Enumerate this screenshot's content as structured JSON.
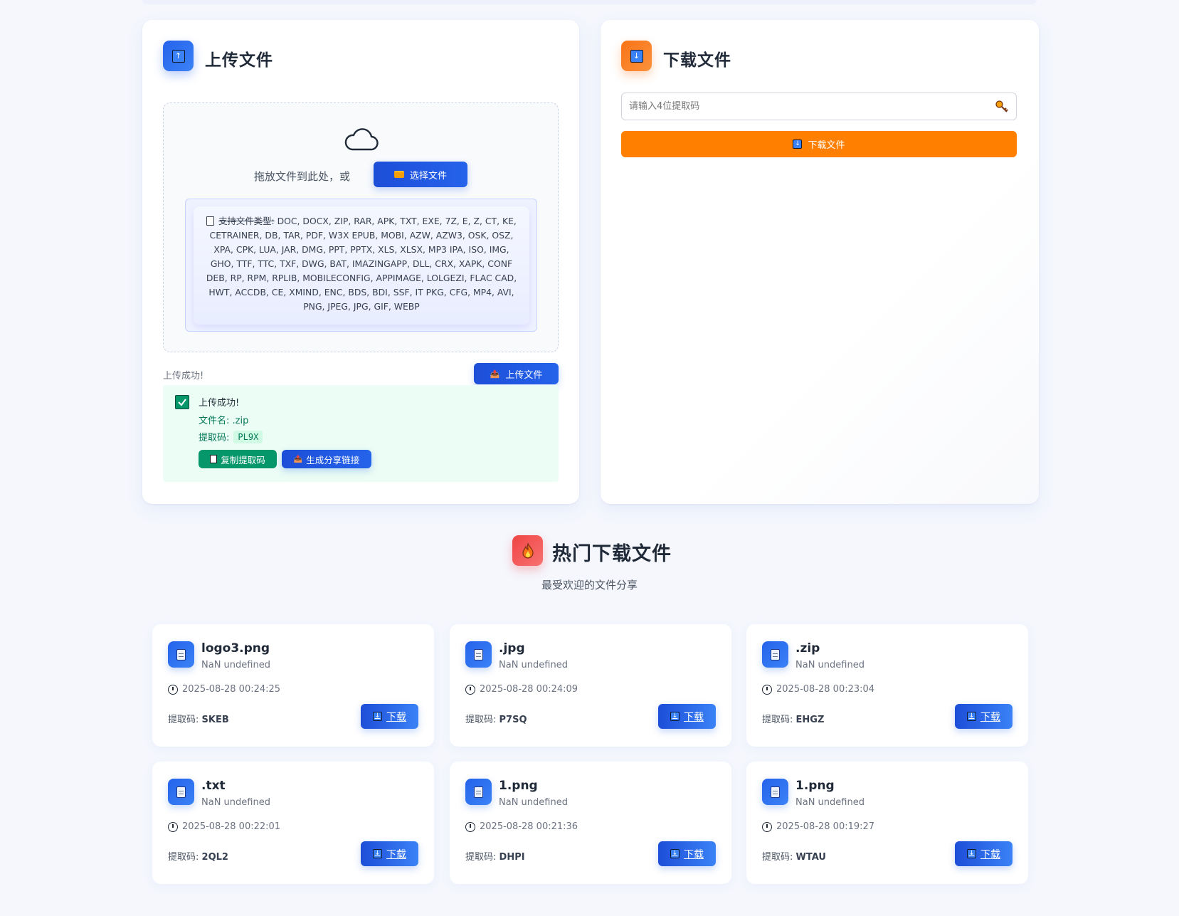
{
  "upload": {
    "title": "上传文件",
    "drop_text": "拖放文件到此处，或",
    "select_button": "选择文件",
    "types_label": "支持文件类型:",
    "types_list": "DOC, DOCX, ZIP, RAR, APK, TXT, EXE, 7Z, E, Z, CT, KE, CETRAINER, DB, TAR, PDF, W3X EPUB, MOBI, AZW, AZW3, OSK, OSZ, XPA, CPK, LUA, JAR, DMG, PPT, PPTX, XLS, XLSX, MP3 IPA, ISO, IMG, GHO, TTF, TTC, TXF, DWG, BAT, IMAZINGAPP, DLL, CRX, XAPK, CONF DEB, RP, RPM, RPLIB, MOBILECONFIG, APPIMAGE, LOLGEZI, FLAC CAD, HWT, ACCDB, CE, XMIND, ENC, BDS, BDI, SSF, IT PKG, CFG, MP4, AVI, PNG, JPEG, JPG, GIF, WEBP",
    "status_text": "上传成功!",
    "upload_button": "上传文件",
    "result": {
      "title": "上传成功!",
      "filename_label": "文件名:",
      "filename": ".zip",
      "code_label": "提取码:",
      "code": "PL9X",
      "copy_button": "复制提取码",
      "share_button": "生成分享链接"
    }
  },
  "download": {
    "title": "下载文件",
    "input_placeholder": "请输入4位提取码",
    "button": "下载文件"
  },
  "hot": {
    "title": "热门下载文件",
    "subtitle": "最受欢迎的文件分享",
    "code_label": "提取码:",
    "download_label": "下载",
    "files": [
      {
        "name": "logo3.png",
        "size": "NaN undefined",
        "time": "2025-08-28 00:24:25",
        "code": "SKEB"
      },
      {
        "name": ".jpg",
        "size": "NaN undefined",
        "time": "2025-08-28 00:24:09",
        "code": "P7SQ"
      },
      {
        "name": ".zip",
        "size": "NaN undefined",
        "time": "2025-08-28 00:23:04",
        "code": "EHGZ"
      },
      {
        "name": ".txt",
        "size": "NaN undefined",
        "time": "2025-08-28 00:22:01",
        "code": "2QL2"
      },
      {
        "name": "1.png",
        "size": "NaN undefined",
        "time": "2025-08-28 00:21:36",
        "code": "DHPI"
      },
      {
        "name": "1.png",
        "size": "NaN undefined",
        "time": "2025-08-28 00:19:27",
        "code": "WTAU"
      }
    ]
  },
  "colors": {
    "primary": "#2563eb",
    "orange": "#ff8000",
    "success": "#059669",
    "hot_red": "#ef4444"
  },
  "icons": {
    "upload": "upload-arrow-icon",
    "download": "download-arrow-icon",
    "cloud": "cloud-icon",
    "folder": "folder-icon",
    "doc": "document-icon",
    "key": "key-icon",
    "check": "check-icon",
    "fire": "fire-icon",
    "clock": "clock-icon"
  }
}
